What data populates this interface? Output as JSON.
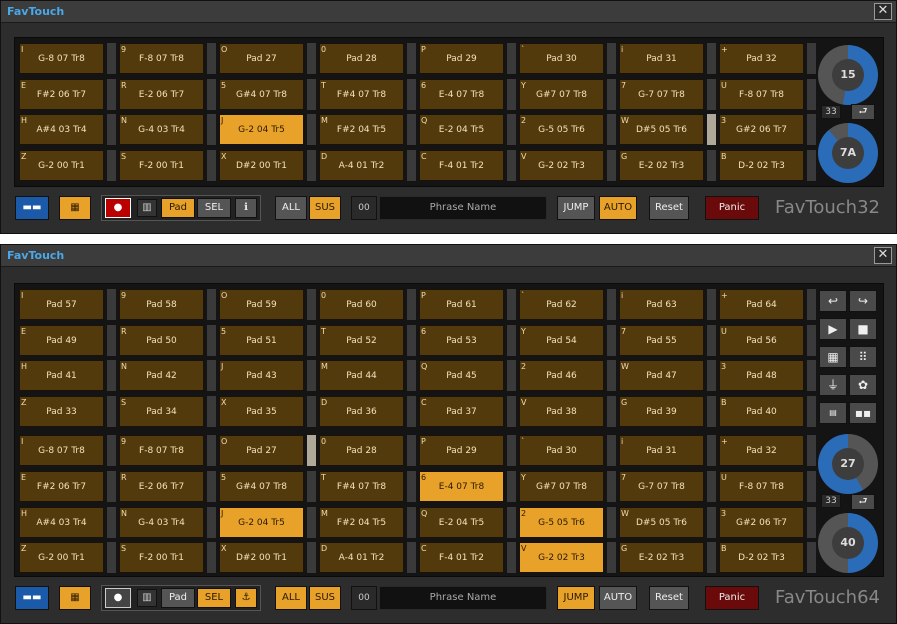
{
  "w1": {
    "title": "FavTouch",
    "close": "✕",
    "logo": "FavTouch32",
    "pads": [
      [
        {
          "k": "I",
          "l": "G-8 07  Tr8"
        },
        {
          "k": "9",
          "l": "F-8 07  Tr8"
        },
        {
          "k": "O",
          "l": "Pad 27"
        },
        {
          "k": "0",
          "l": "Pad 28"
        },
        {
          "k": "P",
          "l": "Pad 29"
        },
        {
          "k": "`",
          "l": "Pad 30"
        },
        {
          "k": "i",
          "l": "Pad 31"
        },
        {
          "k": "+",
          "l": "Pad 32"
        }
      ],
      [
        {
          "k": "E",
          "l": "F#2 06  Tr7"
        },
        {
          "k": "R",
          "l": "E-2 06  Tr7"
        },
        {
          "k": "5",
          "l": "G#4 07  Tr8"
        },
        {
          "k": "T",
          "l": "F#4 07  Tr8"
        },
        {
          "k": "6",
          "l": "E-4 07  Tr8"
        },
        {
          "k": "Y",
          "l": "G#7 07  Tr8"
        },
        {
          "k": "7",
          "l": "G-7 07  Tr8"
        },
        {
          "k": "U",
          "l": "F-8 07  Tr8"
        }
      ],
      [
        {
          "k": "H",
          "l": "A#4 03  Tr4"
        },
        {
          "k": "N",
          "l": "G-4 03  Tr4"
        },
        {
          "k": "J",
          "l": "G-2 04  Tr5",
          "on": true
        },
        {
          "k": "M",
          "l": "F#2 04  Tr5"
        },
        {
          "k": "Q",
          "l": "E-2 04  Tr5"
        },
        {
          "k": "2",
          "l": "G-5 05  Tr6"
        },
        {
          "k": "W",
          "l": "D#5 05  Tr6"
        },
        {
          "k": "3",
          "l": "G#2 06  Tr7"
        }
      ],
      [
        {
          "k": "Z",
          "l": "G-2 00  Tr1"
        },
        {
          "k": "S",
          "l": "F-2 00  Tr1"
        },
        {
          "k": "X",
          "l": "D#2 00  Tr1"
        },
        {
          "k": "D",
          "l": "A-4 01  Tr2"
        },
        {
          "k": "C",
          "l": "F-4 01  Tr2"
        },
        {
          "k": "V",
          "l": "G-2 02  Tr3"
        },
        {
          "k": "G",
          "l": "E-2 02  Tr3"
        },
        {
          "k": "B",
          "l": "D-2 02  Tr3"
        }
      ]
    ],
    "knob1": "15",
    "knob2": "7A",
    "small_num": "33",
    "pad_btn": "Pad",
    "sel_btn": "SEL",
    "all_btn": "ALL",
    "sus_btn": "SUS",
    "phrase_num": "00",
    "phrase_name": "Phrase Name",
    "jump_btn": "JUMP",
    "auto_btn": "AUTO",
    "reset_btn": "Reset",
    "panic_btn": "Panic"
  },
  "w2": {
    "title": "FavTouch",
    "close": "✕",
    "logo": "FavTouch64",
    "pads": [
      [
        {
          "k": "I",
          "l": "Pad 57"
        },
        {
          "k": "9",
          "l": "Pad 58"
        },
        {
          "k": "O",
          "l": "Pad 59"
        },
        {
          "k": "0",
          "l": "Pad 60"
        },
        {
          "k": "P",
          "l": "Pad 61"
        },
        {
          "k": "`",
          "l": "Pad 62"
        },
        {
          "k": "i",
          "l": "Pad 63"
        },
        {
          "k": "+",
          "l": "Pad 64"
        }
      ],
      [
        {
          "k": "E",
          "l": "Pad 49"
        },
        {
          "k": "R",
          "l": "Pad 50"
        },
        {
          "k": "5",
          "l": "Pad 51"
        },
        {
          "k": "T",
          "l": "Pad 52"
        },
        {
          "k": "6",
          "l": "Pad 53"
        },
        {
          "k": "Y",
          "l": "Pad 54"
        },
        {
          "k": "7",
          "l": "Pad 55"
        },
        {
          "k": "U",
          "l": "Pad 56"
        }
      ],
      [
        {
          "k": "H",
          "l": "Pad 41"
        },
        {
          "k": "N",
          "l": "Pad 42"
        },
        {
          "k": "J",
          "l": "Pad 43"
        },
        {
          "k": "M",
          "l": "Pad 44"
        },
        {
          "k": "Q",
          "l": "Pad 45"
        },
        {
          "k": "2",
          "l": "Pad 46"
        },
        {
          "k": "W",
          "l": "Pad 47"
        },
        {
          "k": "3",
          "l": "Pad 48"
        }
      ],
      [
        {
          "k": "Z",
          "l": "Pad 33"
        },
        {
          "k": "S",
          "l": "Pad 34"
        },
        {
          "k": "X",
          "l": "Pad 35"
        },
        {
          "k": "D",
          "l": "Pad 36"
        },
        {
          "k": "C",
          "l": "Pad 37"
        },
        {
          "k": "V",
          "l": "Pad 38"
        },
        {
          "k": "G",
          "l": "Pad 39"
        },
        {
          "k": "B",
          "l": "Pad 40"
        }
      ],
      [
        {
          "k": "I",
          "l": "G-8 07  Tr8"
        },
        {
          "k": "9",
          "l": "F-8 07  Tr8"
        },
        {
          "k": "O",
          "l": "Pad 27"
        },
        {
          "k": "0",
          "l": "Pad 28"
        },
        {
          "k": "P",
          "l": "Pad 29"
        },
        {
          "k": "`",
          "l": "Pad 30"
        },
        {
          "k": "i",
          "l": "Pad 31"
        },
        {
          "k": "+",
          "l": "Pad 32"
        }
      ],
      [
        {
          "k": "E",
          "l": "F#2 06  Tr7"
        },
        {
          "k": "R",
          "l": "E-2 06  Tr7"
        },
        {
          "k": "5",
          "l": "G#4 07  Tr8"
        },
        {
          "k": "T",
          "l": "F#4 07  Tr8"
        },
        {
          "k": "6",
          "l": "E-4 07  Tr8",
          "on": true
        },
        {
          "k": "Y",
          "l": "G#7 07  Tr8"
        },
        {
          "k": "7",
          "l": "G-7 07  Tr8"
        },
        {
          "k": "U",
          "l": "F-8 07  Tr8"
        }
      ],
      [
        {
          "k": "H",
          "l": "A#4 03  Tr4"
        },
        {
          "k": "N",
          "l": "G-4 03  Tr4"
        },
        {
          "k": "J",
          "l": "G-2 04  Tr5",
          "on": true
        },
        {
          "k": "M",
          "l": "F#2 04  Tr5"
        },
        {
          "k": "Q",
          "l": "E-2 04  Tr5"
        },
        {
          "k": "2",
          "l": "G-5 05  Tr6",
          "on": true
        },
        {
          "k": "W",
          "l": "D#5 05  Tr6"
        },
        {
          "k": "3",
          "l": "G#2 06  Tr7"
        }
      ],
      [
        {
          "k": "Z",
          "l": "G-2 00  Tr1"
        },
        {
          "k": "S",
          "l": "F-2 00  Tr1"
        },
        {
          "k": "X",
          "l": "D#2 00  Tr1"
        },
        {
          "k": "D",
          "l": "A-4 01  Tr2"
        },
        {
          "k": "C",
          "l": "F-4 01  Tr2"
        },
        {
          "k": "V",
          "l": "G-2 02  Tr3",
          "on": true
        },
        {
          "k": "G",
          "l": "E-2 02  Tr3"
        },
        {
          "k": "B",
          "l": "D-2 02  Tr3"
        }
      ]
    ],
    "knob1": "27",
    "knob2": "40",
    "small_num": "33",
    "pad_btn": "Pad",
    "sel_btn": "SEL",
    "all_btn": "ALL",
    "sus_btn": "SUS",
    "phrase_num": "00",
    "phrase_name": "Phrase Name",
    "jump_btn": "JUMP",
    "auto_btn": "AUTO",
    "reset_btn": "Reset",
    "panic_btn": "Panic"
  }
}
